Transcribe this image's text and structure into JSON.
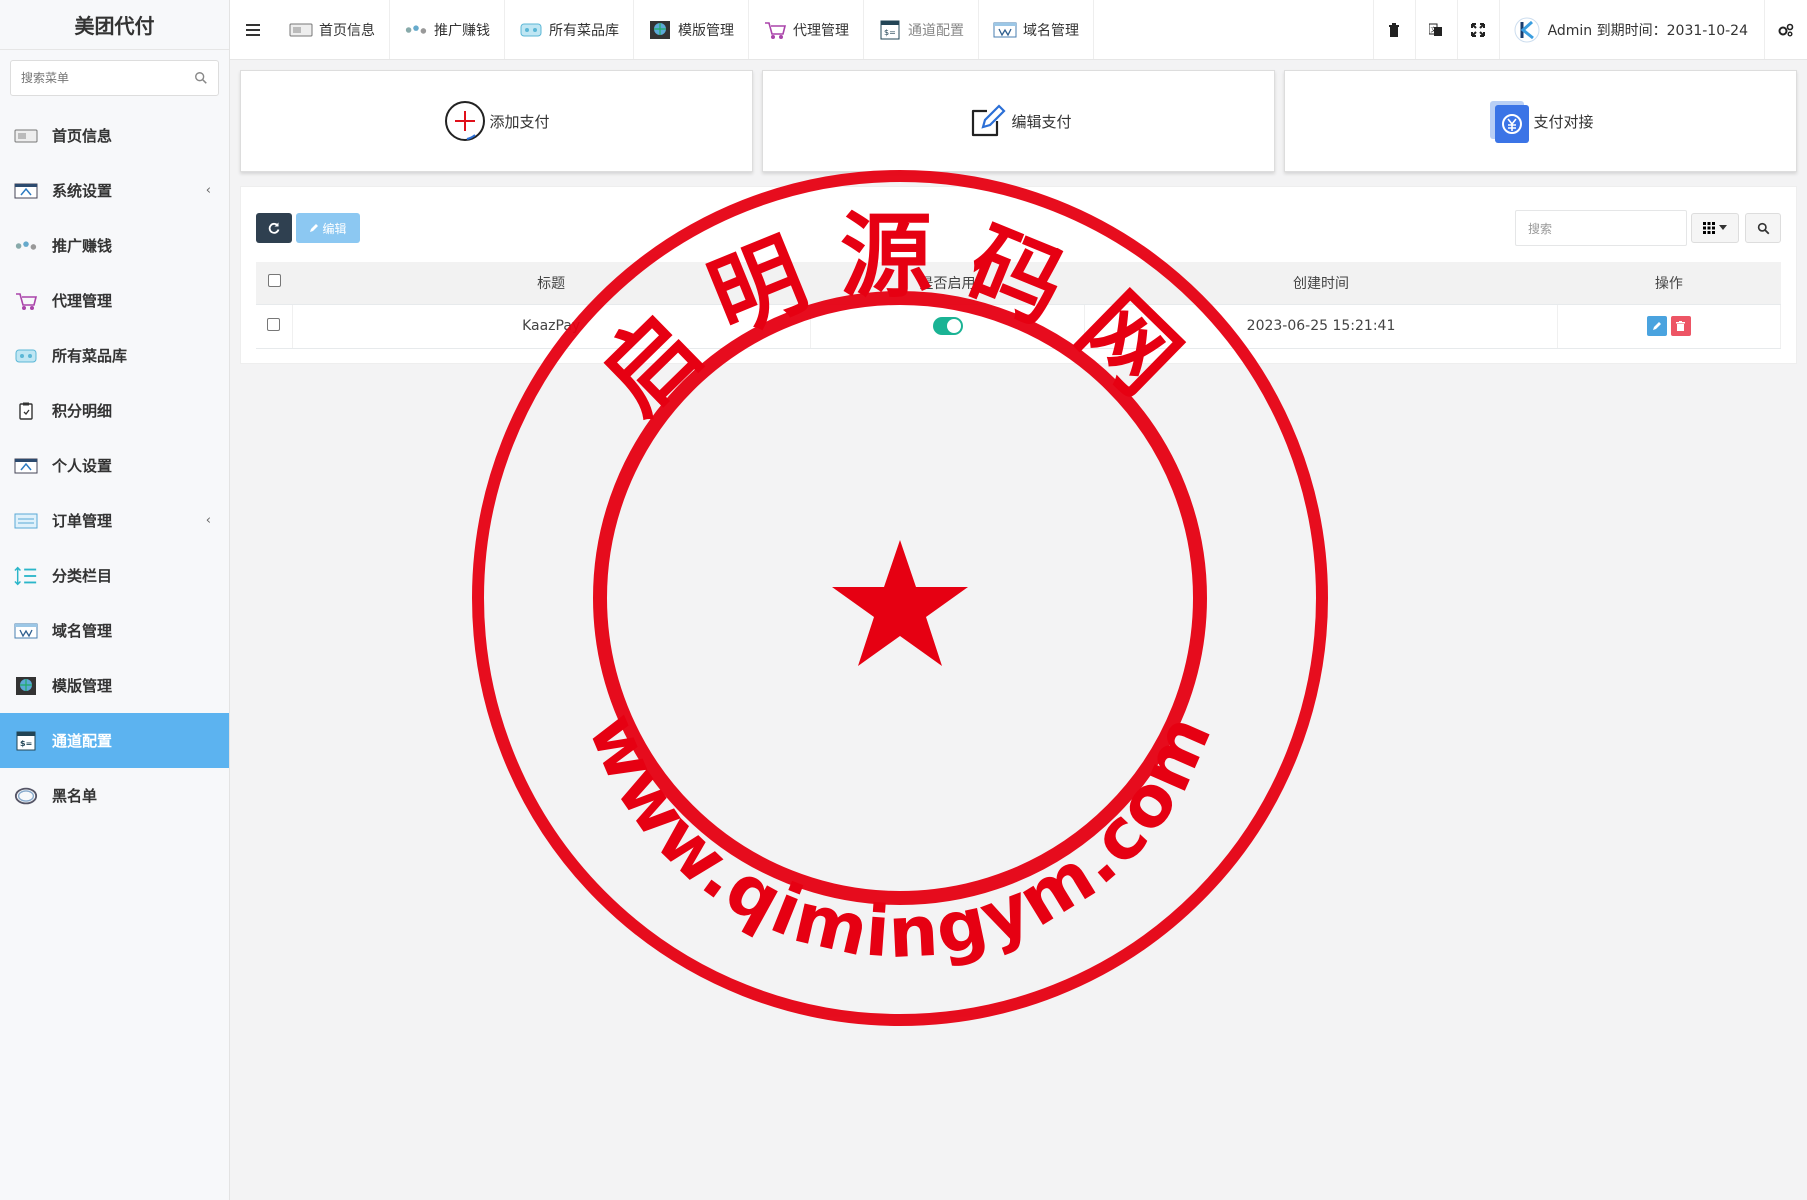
{
  "app": {
    "title": "美团代付"
  },
  "sidebar": {
    "search_placeholder": "搜索菜单",
    "items": [
      {
        "label": "首页信息",
        "icon": "home-card-icon"
      },
      {
        "label": "系统设置",
        "icon": "settings-window-icon",
        "has_caret": true
      },
      {
        "label": "推广赚钱",
        "icon": "promote-icon"
      },
      {
        "label": "代理管理",
        "icon": "agent-cart-icon"
      },
      {
        "label": "所有菜品库",
        "icon": "dishes-icon"
      },
      {
        "label": "积分明细",
        "icon": "points-clipboard-icon"
      },
      {
        "label": "个人设置",
        "icon": "personal-settings-icon"
      },
      {
        "label": "订单管理",
        "icon": "orders-icon",
        "has_caret": true
      },
      {
        "label": "分类栏目",
        "icon": "category-list-icon"
      },
      {
        "label": "域名管理",
        "icon": "domain-icon"
      },
      {
        "label": "模版管理",
        "icon": "template-globe-icon"
      },
      {
        "label": "通道配置",
        "icon": "channel-config-icon",
        "active": true
      },
      {
        "label": "黑名单",
        "icon": "blacklist-ring-icon"
      }
    ],
    "caret": "‹"
  },
  "topbar": {
    "tabs": [
      {
        "label": "首页信息",
        "icon": "home-card-icon"
      },
      {
        "label": "推广赚钱",
        "icon": "promote-icon"
      },
      {
        "label": "所有菜品库",
        "icon": "dishes-icon"
      },
      {
        "label": "模版管理",
        "icon": "template-globe-icon"
      },
      {
        "label": "代理管理",
        "icon": "agent-cart-icon"
      },
      {
        "label": "通道配置",
        "icon": "channel-config-icon",
        "muted": true
      },
      {
        "label": "域名管理",
        "icon": "domain-icon"
      }
    ],
    "user_text": "Admin 到期时间：2031-10-24"
  },
  "cards": [
    {
      "label": "添加支付",
      "icon": "add-circle-icon"
    },
    {
      "label": "编辑支付",
      "icon": "edit-pen-icon"
    },
    {
      "label": "支付对接",
      "icon": "yuan-payment-icon"
    }
  ],
  "toolbar": {
    "edit_label": "编辑",
    "search_placeholder": "搜索"
  },
  "table": {
    "columns": [
      "标题",
      "是否启用",
      "创建时间",
      "操作"
    ],
    "rows": [
      {
        "title": "KaazPay",
        "enabled": true,
        "created": "2023-06-25 15:21:41"
      }
    ]
  },
  "watermark": {
    "top_text": "启明源码网",
    "bottom_text": "www.qimingym.com",
    "color": "#e60012"
  },
  "colors": {
    "active_menu": "#5cb3f0",
    "refresh_button": "#2f4050",
    "toggle_on": "#1ab394",
    "delete_button": "#ed5565",
    "edit_button": "#4aa3df"
  }
}
